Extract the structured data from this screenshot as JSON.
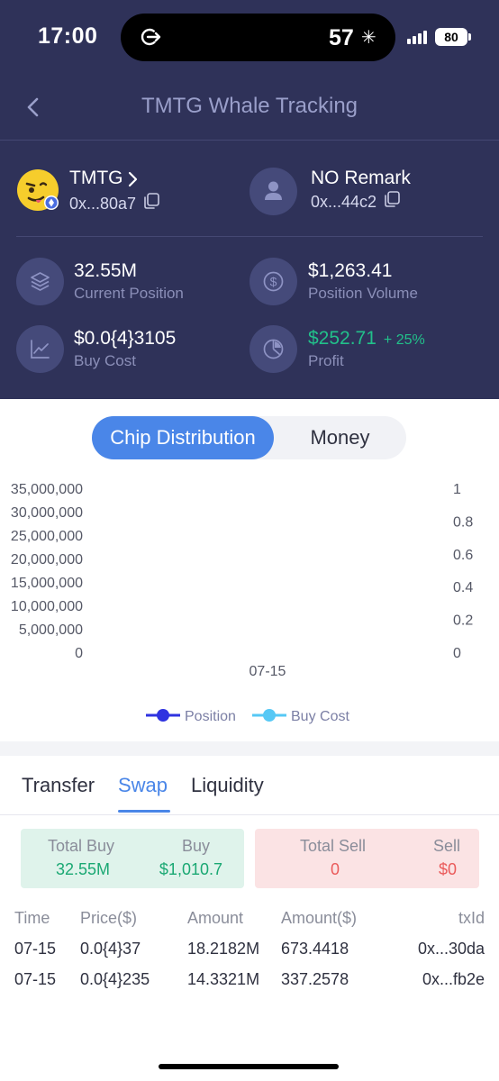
{
  "status": {
    "time": "17:00",
    "island_value": "57",
    "island_icon": "✳",
    "battery": "80"
  },
  "nav": {
    "title": "TMTG Whale Tracking",
    "back_icon": "chevron-left-icon"
  },
  "token": {
    "name": "TMTG",
    "address": "0x...80a7"
  },
  "wallet": {
    "remark": "NO Remark",
    "address": "0x...44c2"
  },
  "stats": {
    "position": {
      "value": "32.55M",
      "label": "Current Position"
    },
    "volume": {
      "value": "$1,263.41",
      "label": "Position Volume"
    },
    "buy_cost": {
      "value": "$0.0{4}3105",
      "label": "Buy Cost"
    },
    "profit": {
      "value": "$252.71",
      "change": "+ 25%",
      "label": "Profit"
    }
  },
  "segment": {
    "active": "Chip Distribution",
    "inactive": "Money"
  },
  "chart_data": {
    "type": "line",
    "categories": [
      "07-15"
    ],
    "series": [
      {
        "name": "Position",
        "values": [],
        "color": "#2f33e0"
      },
      {
        "name": "Buy Cost",
        "values": [],
        "color": "#56c8f5"
      }
    ],
    "y_left": {
      "ticks": [
        "35,000,000",
        "30,000,000",
        "25,000,000",
        "20,000,000",
        "15,000,000",
        "10,000,000",
        "5,000,000",
        "0"
      ],
      "range": [
        0,
        35000000
      ]
    },
    "y_right": {
      "ticks": [
        "1",
        "0.8",
        "0.6",
        "0.4",
        "0.2",
        "0"
      ],
      "range": [
        0,
        1
      ]
    },
    "legend": "bottom-center",
    "grid": false
  },
  "tabs": {
    "items": [
      "Transfer",
      "Swap",
      "Liquidity"
    ],
    "active": "Swap"
  },
  "summary": {
    "total_buy_label": "Total Buy",
    "total_buy": "32.55M",
    "buy_label": "Buy",
    "buy": "$1,010.7",
    "total_sell_label": "Total Sell",
    "total_sell": "0",
    "sell_label": "Sell",
    "sell": "$0"
  },
  "table": {
    "headers": [
      "Time",
      "Price($)",
      "Amount",
      "Amount($)",
      "txId"
    ],
    "rows": [
      [
        "07-15",
        "0.0{4}37",
        "18.2182M",
        "673.4418",
        "0x...30da"
      ],
      [
        "07-15",
        "0.0{4}235",
        "14.3321M",
        "337.2578",
        "0x...fb2e"
      ]
    ]
  }
}
